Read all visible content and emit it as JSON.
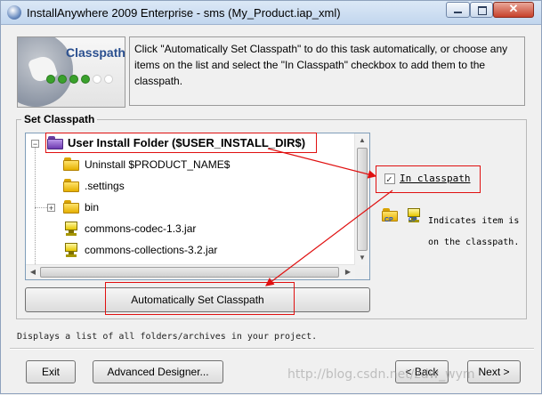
{
  "window": {
    "title": "InstallAnywhere 2009 Enterprise - sms (My_Product.iap_xml)",
    "close_glyph": "✕"
  },
  "header": {
    "logo_title": "Classpath",
    "progress_dots": [
      "#3aa12c",
      "#3aa12c",
      "#3aa12c",
      "#3aa12c",
      "#ffffff",
      "#ffffff"
    ],
    "description": "Click \"Automatically Set Classpath\" to do this task automatically, or choose any items on the list and select the \"In Classpath\" checkbox to add them to the classpath."
  },
  "group": {
    "label": "Set Classpath"
  },
  "tree": {
    "items": [
      {
        "label": "User Install Folder ($USER_INSTALL_DIR$)",
        "icon": "purple-folder-icon",
        "expander": "−"
      },
      {
        "label": "Uninstall $PRODUCT_NAME$",
        "icon": "folder-icon"
      },
      {
        "label": ".settings",
        "icon": "folder-icon"
      },
      {
        "label": "bin",
        "icon": "folder-icon",
        "expander": "+"
      },
      {
        "label": "commons-codec-1.3.jar",
        "icon": "jar-icon"
      },
      {
        "label": "commons-collections-3.2.jar",
        "icon": "jar-icon"
      }
    ],
    "scroll_arrows": {
      "up": "▲",
      "down": "▼",
      "left": "◀",
      "right": "▶"
    }
  },
  "in_classpath": {
    "label": "In classpath",
    "checked": true,
    "mark": "✓"
  },
  "legend": {
    "text": "Indicates item is on the classpath.",
    "icons": [
      "classpath-folder-icon",
      "classpath-jar-icon"
    ],
    "cp_tag": "CP"
  },
  "auto_button": {
    "label": "Automatically Set Classpath"
  },
  "status": {
    "text": "Displays a list of all folders/archives in your project."
  },
  "footer": {
    "exit": "Exit",
    "advanced": "Advanced Designer...",
    "back": "< Back",
    "next": "Next >"
  },
  "watermark": {
    "text": "http://blog.csdn.net/zdw_wym"
  },
  "colors": {
    "annotation": "#e01010",
    "logo_title": "#2a4f8f"
  }
}
